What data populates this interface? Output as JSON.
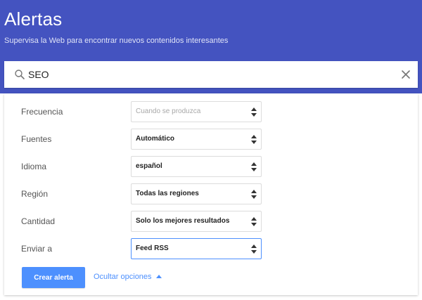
{
  "header": {
    "title": "Alertas",
    "subtitle": "Supervisa la Web para encontrar nuevos contenidos interesantes",
    "background_color": "#4453c0"
  },
  "search": {
    "value": "SEO",
    "icon": "search-icon",
    "clear_icon": "close-icon"
  },
  "options": [
    {
      "id": "frecuencia",
      "label": "Frecuencia",
      "value": "Cuando se produzca",
      "disabled": true
    },
    {
      "id": "fuentes",
      "label": "Fuentes",
      "value": "Automático",
      "disabled": false
    },
    {
      "id": "idioma",
      "label": "Idioma",
      "value": "español",
      "disabled": false
    },
    {
      "id": "region",
      "label": "Región",
      "value": "Todas las regiones",
      "disabled": false
    },
    {
      "id": "cantidad",
      "label": "Cantidad",
      "value": "Solo los mejores resultados",
      "disabled": false
    },
    {
      "id": "enviar-a",
      "label": "Enviar a",
      "value": "Feed RSS",
      "disabled": false,
      "focused": true
    }
  ],
  "actions": {
    "create_label": "Crear alerta",
    "hide_options_label": "Ocultar opciones",
    "accent_color": "#4d90fe"
  }
}
